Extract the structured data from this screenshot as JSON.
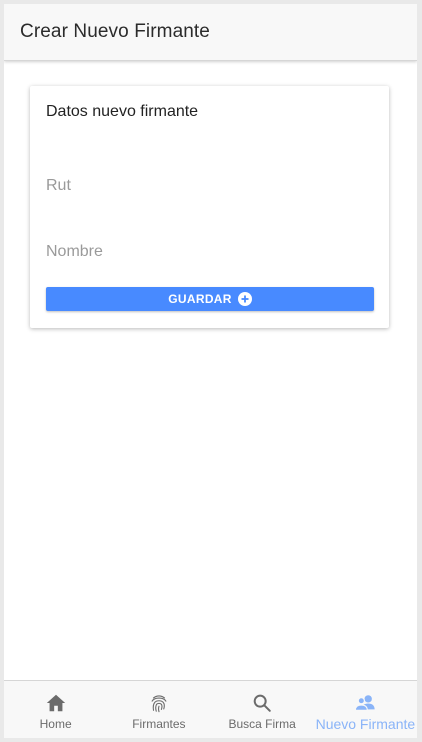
{
  "header": {
    "title": "Crear Nuevo Firmante"
  },
  "form": {
    "title": "Datos nuevo firmante",
    "rut_placeholder": "Rut",
    "nombre_placeholder": "Nombre",
    "save_label": "GUARDAR",
    "save_icon": "add-circle-icon"
  },
  "tabs": [
    {
      "label": "Home",
      "icon": "home-icon",
      "active": false
    },
    {
      "label": "Firmantes",
      "icon": "fingerprint-icon",
      "active": false
    },
    {
      "label": "Busca Firma",
      "icon": "search-icon",
      "active": false
    },
    {
      "label": "Nuevo Firmante",
      "icon": "people-icon",
      "active": true
    }
  ],
  "colors": {
    "primary": "#488aff",
    "active_tab": "#8ab4f8",
    "inactive_tab": "#6b6b6b",
    "header_bg": "#f8f8f8"
  }
}
